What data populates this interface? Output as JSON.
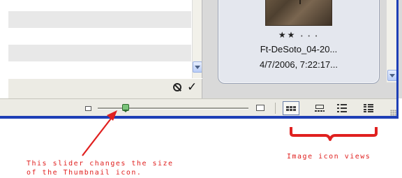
{
  "thumbnail": {
    "rating_filled": "★★",
    "rating_empty": "• • •",
    "filename": "Ft-DeSoto_04-20...",
    "datetime": "4/7/2006, 7:22:17..."
  },
  "icons": {
    "cancel": "cancel-icon",
    "apply": "checkmark-icon",
    "slider_min": "small-thumbnail-icon",
    "slider_max": "large-thumbnail-icon",
    "views": [
      "thumbnails-view-icon",
      "filmstrip-view-icon",
      "list-view-icon",
      "details-view-icon"
    ]
  },
  "toolbar": {
    "apply_label": "✓",
    "thumbnail_size_fraction": 0.18,
    "active_view": "thumbnails"
  },
  "annotations": {
    "slider_note_line1": "This slider changes the size",
    "slider_note_line2": "of the Thumbnail icon.",
    "views_note": "Image icon views"
  },
  "colors": {
    "annotation": "#e0201f",
    "frame": "#1e3fb6",
    "slider_thumb": "#7bc47b"
  }
}
